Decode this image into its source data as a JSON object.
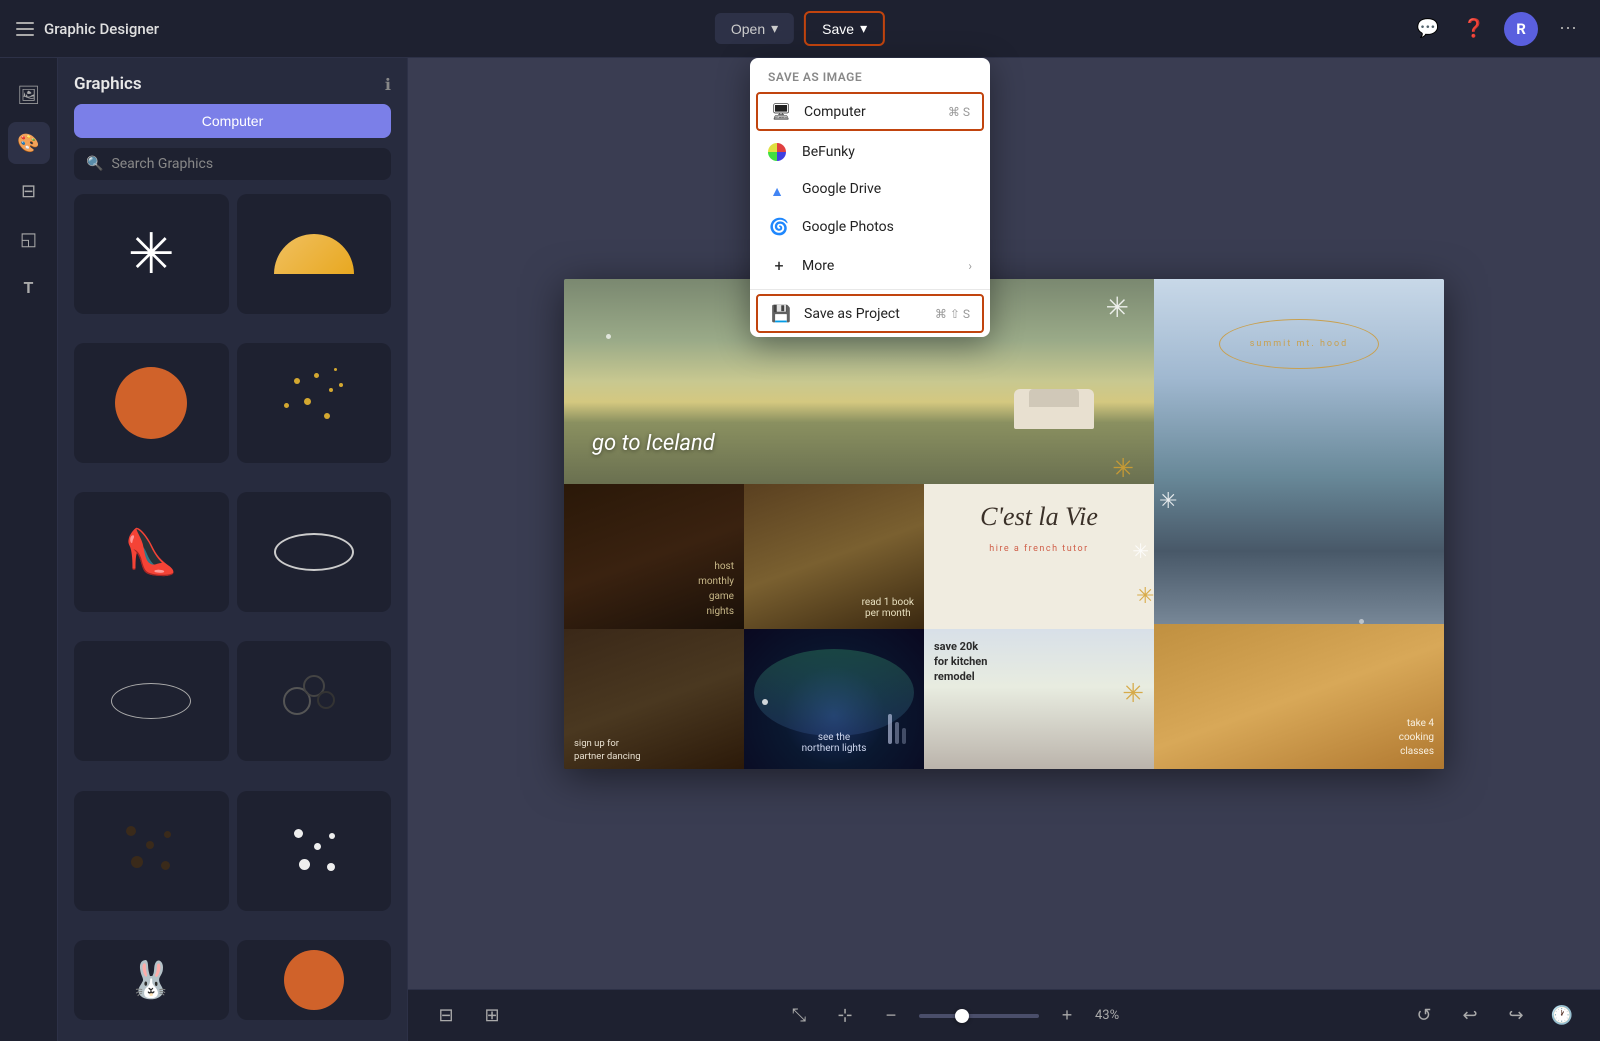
{
  "app": {
    "title": "Graphic Designer",
    "avatar_initial": "R"
  },
  "topbar": {
    "open_label": "Open",
    "save_label": "Save",
    "open_chevron": "▾",
    "save_chevron": "▾"
  },
  "sidebar": {
    "title": "Graphics",
    "tab_computer": "Computer",
    "search_placeholder": "Search Graphics"
  },
  "dropdown": {
    "section_title": "Save as Image",
    "items": [
      {
        "id": "computer",
        "label": "Computer",
        "shortcut": "⌘ S",
        "highlighted": true
      },
      {
        "id": "befunky",
        "label": "BeFunky",
        "shortcut": ""
      },
      {
        "id": "google-drive",
        "label": "Google Drive",
        "shortcut": ""
      },
      {
        "id": "google-photos",
        "label": "Google Photos",
        "shortcut": ""
      },
      {
        "id": "more",
        "label": "More",
        "shortcut": "",
        "has_chevron": true
      }
    ],
    "save_project_label": "Save as Project",
    "save_project_shortcut": "⌘ ⇧ S"
  },
  "canvas": {
    "iceland_text": "go to Iceland",
    "summit_text": "summit mt. hood",
    "french_title": "C'est la Vie",
    "french_sub": "hire a french tutor",
    "game_text": "host\nmonthly\ngame\nnights",
    "book_text": "read 1 book\nper month",
    "dance_text": "sign up for\npartner dancing",
    "northern_text": "see the\nnorthern lights",
    "kitchen_text": "save 20k\nfor kitchen\nremodel",
    "croissant_text": "take 4\ncooking\nclasses"
  },
  "bottombar": {
    "zoom_percent": "43%"
  }
}
